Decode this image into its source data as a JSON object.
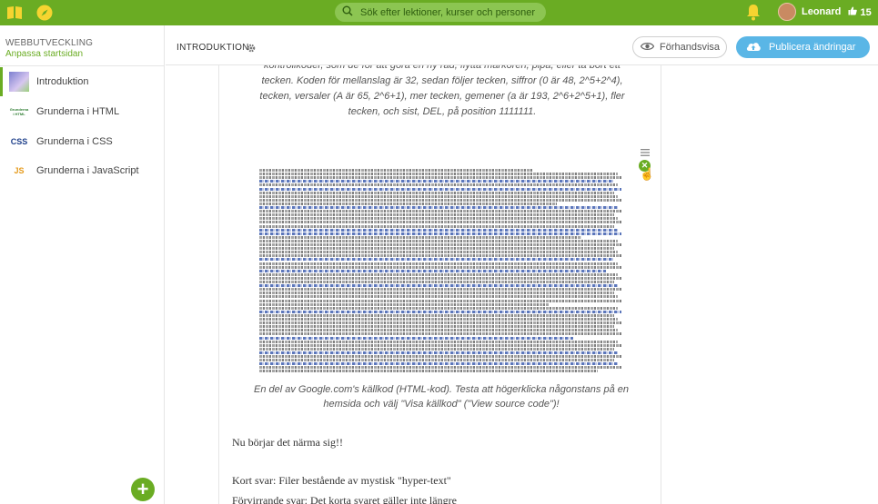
{
  "topbar": {
    "search_placeholder": "Sök efter lektioner, kurser och personer",
    "user_name": "Leonard",
    "likes": "15",
    "accent": "#6aac23"
  },
  "sidebar": {
    "course_title": "WEBBUTVECKLING",
    "course_link": "Anpassa startsidan",
    "items": [
      {
        "label": "Introduktion",
        "thumb": "",
        "active": true
      },
      {
        "label": "Grunderna i HTML",
        "thumb": "Grunderna i HTML"
      },
      {
        "label": "Grunderna i CSS",
        "thumb": "CSS"
      },
      {
        "label": "Grunderna i JavaScript",
        "thumb": "JS"
      }
    ],
    "add_label": "+"
  },
  "header": {
    "lesson_title": "INTRODUKTION",
    "preview_label": "Förhandsvisa",
    "publish_label": "Publicera ändringar"
  },
  "content": {
    "intro_paragraph": "kontrollkoder, som de för att göra en ny rad, flytta markören, pipa, eller ta bort ett tecken. Koden för mellanslag är 32, sedan följer tecken, siffror (0 är 48, 2^5+2^4), tecken, versaler (A är 65, 2^6+1), mer tecken, gemener (a är 193, 2^6+2^5+1), fler tecken, och sist, DEL, på position 1111111.",
    "image_caption": "En del av Google.com's källkod (HTML-kod). Testa att högerklicka någonstans på en hemsida och välj \"Visa källkod\" (\"View source code\")!",
    "paragraph_1": "Nu börjar det närma sig!!",
    "paragraph_2": "Kort svar: Filer bestående av mystisk \"hyper-text\"",
    "paragraph_3": "Förvirrande svar: Det korta svaret gäller inte längre"
  }
}
